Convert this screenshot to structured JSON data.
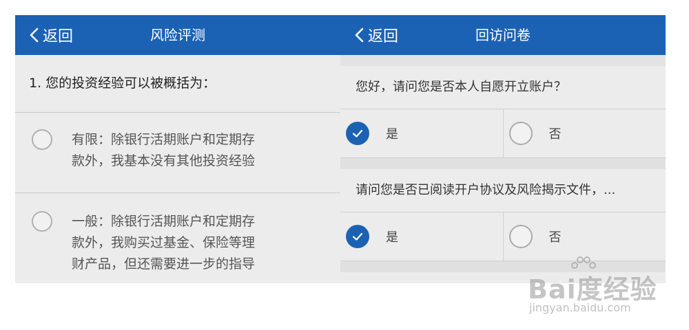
{
  "left_screen": {
    "header": {
      "back_label": "返回",
      "title": "风险评测"
    },
    "question": "1. 您的投资经验可以被概括为：",
    "options": [
      {
        "lines": [
          "有限：除银行活期账户和定期存",
          "款外，我基本没有其他投资经验"
        ]
      },
      {
        "lines": [
          "一般：除银行活期账户和定期存",
          "款外，我购买过基金、保险等理",
          "财产品，但还需要进一步的指导"
        ]
      }
    ]
  },
  "right_screen": {
    "header": {
      "back_label": "返回",
      "title": "回访问卷"
    },
    "questions": [
      {
        "text": "您好，请问您是否本人自愿开立账户？",
        "yes_label": "是",
        "no_label": "否",
        "selected": "yes"
      },
      {
        "text": "请问您是否已阅读开户协议及风险揭示文件，...",
        "yes_label": "是",
        "no_label": "否",
        "selected": "yes"
      }
    ]
  },
  "watermark": {
    "main": "Bai度经验",
    "sub": "jingyan.baidu.com"
  },
  "colors": {
    "header_bg": "#1b62b4",
    "panel_bg": "#ececec",
    "check_bg": "#1b62b4"
  },
  "icons": {
    "back": "chevron-left-icon",
    "checked": "check-circle-icon",
    "unchecked": "radio-empty-icon"
  }
}
